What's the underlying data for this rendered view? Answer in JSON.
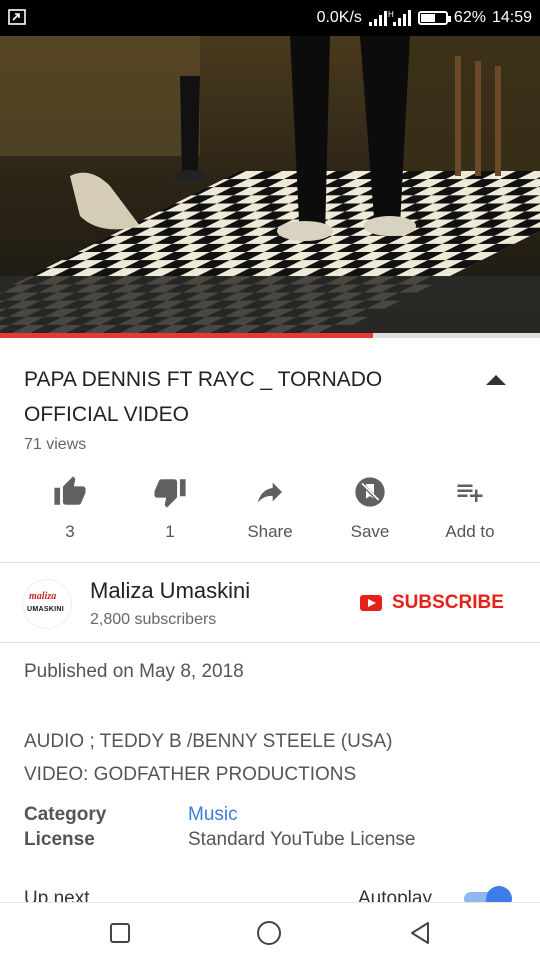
{
  "status_bar": {
    "network_speed": "0.0K/s",
    "battery_percent": "62%",
    "battery_level": 0.62,
    "time": "14:59"
  },
  "player": {
    "progress": 0.69
  },
  "video": {
    "title": "PAPA DENNIS FT RAYC _ TORNADO OFFICIAL VIDEO",
    "views": "71 views"
  },
  "actions": [
    {
      "icon": "thumbs-up-icon",
      "label": "3"
    },
    {
      "icon": "thumbs-down-icon",
      "label": "1"
    },
    {
      "icon": "share-icon",
      "label": "Share"
    },
    {
      "icon": "save-icon",
      "label": "Save"
    },
    {
      "icon": "add-to-playlist-icon",
      "label": "Add to"
    }
  ],
  "channel": {
    "name": "Maliza Umaskini",
    "subscribers": "2,800 subscribers",
    "avatar_text_top": "maliza",
    "avatar_text_bottom": "UMASKINI",
    "subscribe_label": "SUBSCRIBE"
  },
  "details": {
    "published": "Published on May 8, 2018",
    "description_lines": [
      "AUDIO ; TEDDY B /BENNY STEELE (USA)",
      "VIDEO: GODFATHER PRODUCTIONS"
    ],
    "category_label": "Category",
    "category_value": "Music",
    "license_label": "License",
    "license_value": "Standard YouTube License"
  },
  "up_next": {
    "label": "Up next",
    "autoplay_label": "Autoplay",
    "autoplay_on": true
  },
  "colors": {
    "accent_red": "#e62117",
    "link_blue": "#3b7dd8",
    "toggle_blue": "#3d7de8"
  }
}
